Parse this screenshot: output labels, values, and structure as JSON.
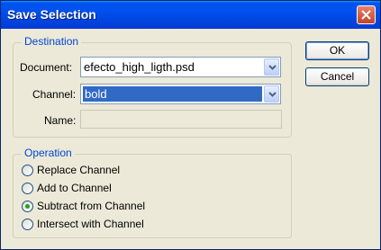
{
  "window": {
    "title": "Save Selection"
  },
  "destination": {
    "legend": "Destination",
    "document_label": "Document:",
    "document_value": "efecto_high_ligth.psd",
    "channel_label": "Channel:",
    "channel_value": "bold",
    "name_label": "Name:",
    "name_value": ""
  },
  "operation": {
    "legend": "Operation",
    "options": [
      {
        "label": "Replace Channel",
        "checked": false
      },
      {
        "label": "Add to Channel",
        "checked": false
      },
      {
        "label": "Subtract from Channel",
        "checked": true
      },
      {
        "label": "Intersect with Channel",
        "checked": false
      }
    ]
  },
  "buttons": {
    "ok": "OK",
    "cancel": "Cancel"
  },
  "colors": {
    "titlebar": "#0050ee",
    "dialog_bg": "#ece9d8",
    "legend_text": "#0046d5",
    "selection": "#316ac5"
  }
}
